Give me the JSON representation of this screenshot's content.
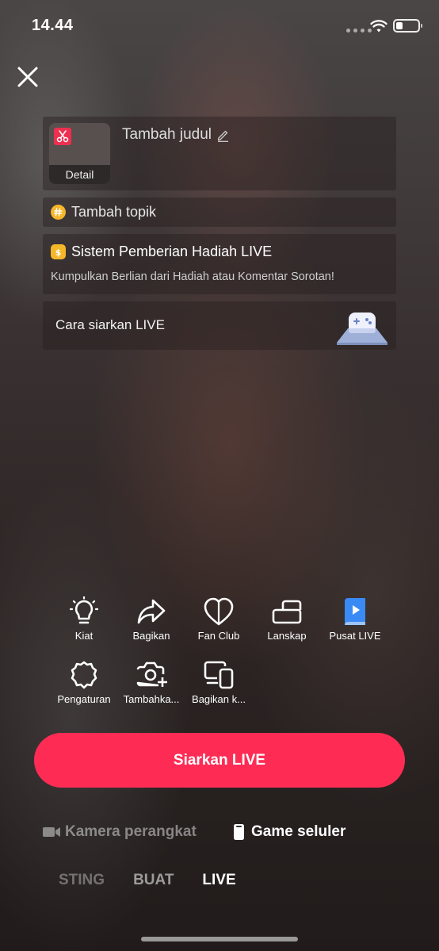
{
  "status_bar": {
    "time": "14.44"
  },
  "setup": {
    "thumbnail_label": "Detail",
    "title_placeholder": "Tambah judul",
    "topic_label": "Tambah topik",
    "gift_title": "Sistem Pemberian Hadiah LIVE",
    "gift_subtitle": "Kumpulkan Berlian dari Hadiah atau Komentar Sorotan!",
    "howto_label": "Cara siarkan LIVE"
  },
  "tools": [
    {
      "label": "Kiat",
      "icon": "lightbulb-icon"
    },
    {
      "label": "Bagikan",
      "icon": "share-icon"
    },
    {
      "label": "Fan Club",
      "icon": "heart-icon"
    },
    {
      "label": "Lanskap",
      "icon": "landscape-icon"
    },
    {
      "label": "Pusat LIVE",
      "icon": "book-icon"
    },
    {
      "label": "Pengaturan",
      "icon": "gear-icon"
    },
    {
      "label": "Tambahka...",
      "icon": "camera-plus-icon"
    },
    {
      "label": "Bagikan k...",
      "icon": "devices-icon"
    }
  ],
  "go_live_button": "Siarkan LIVE",
  "source_modes": {
    "camera": "Kamera perangkat",
    "game": "Game seluler"
  },
  "bottom_tabs": [
    "STING",
    "BUAT",
    "LIVE"
  ],
  "colors": {
    "accent": "#fe2c55",
    "emoji": "#f5b72a",
    "cut_icon": "#ee2f4f"
  }
}
